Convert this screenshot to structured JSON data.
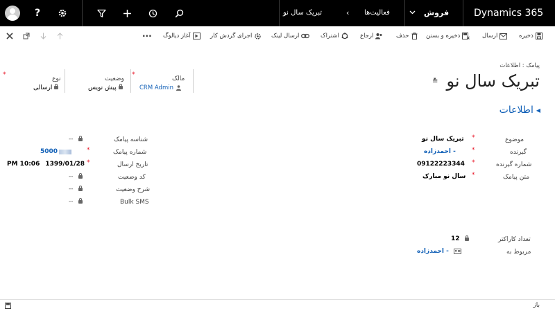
{
  "nav": {
    "app_name": "Dynamics 365",
    "area": "فروش",
    "breadcrumb_section": "فعالیت‌ها",
    "breadcrumb_record": "تبریک سال نو",
    "help_label": "?"
  },
  "commands": {
    "save": "ذخیره",
    "send": "ارسال",
    "save_close": "ذخیره و بستن",
    "delete": "حذف",
    "assign": "ارجاع",
    "share": "اشتراک",
    "email_link": "ارسال لینک",
    "run_workflow": "اجرای گردش کار",
    "start_dialog": "آغاز دیالوگ",
    "more": "..."
  },
  "header": {
    "entity": "پیامک : اطلاعات",
    "title": "تبریک سال نو",
    "owner_label": "مالک",
    "owner_value": "CRM Admin",
    "status_label": "وضعیت",
    "status_value": "پیش نویس",
    "type_label": "نوع",
    "type_value": "ارسالی"
  },
  "section": {
    "title": "اطلاعات"
  },
  "left_fields": [
    {
      "label": "موضوع",
      "value": "تبریک سال نو"
    },
    {
      "label": "گیرنده",
      "value": "- احمدزاده"
    },
    {
      "label": "شماره گیرنده",
      "value": "09122223344"
    },
    {
      "label": "متن پیامک",
      "value": "سال نو مبارک"
    }
  ],
  "right_fields": [
    {
      "label": "شناسه پیامک",
      "value": "--"
    },
    {
      "label": "شماره پیامک",
      "value": "5000"
    },
    {
      "label": "تاریخ ارسال",
      "date": "1399/01/28",
      "time": "PM 10:06"
    },
    {
      "label": "کد وضعیت",
      "value": "--"
    },
    {
      "label": "شرح وضعیت",
      "value": "--"
    },
    {
      "label": "Bulk SMS",
      "value": "--"
    }
  ],
  "bottom_fields": [
    {
      "label": "تعداد کاراکتر",
      "value": "12"
    },
    {
      "label": "مربوط به",
      "value": "- احمدزاده"
    }
  ],
  "status_bar": {
    "label": "باز"
  }
}
